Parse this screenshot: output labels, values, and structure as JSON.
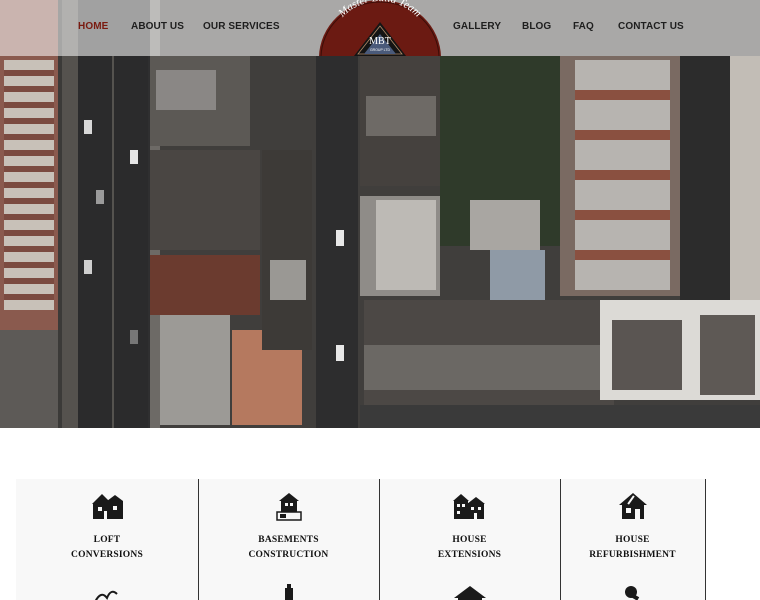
{
  "nav": {
    "left": [
      "HOME",
      "ABOUT US",
      "OUR SERVICES"
    ],
    "right": [
      "GALLERY",
      "BLOG",
      "FAQ",
      "CONTACT US"
    ],
    "active": "HOME"
  },
  "logo": {
    "arc_text": "Master Build Team",
    "initials": "MBT",
    "sub_text": "GROUP LTD"
  },
  "services": [
    {
      "line1": "LOFT",
      "line2": "CONVERSIONS",
      "icon": "house-icon"
    },
    {
      "line1": "BASEMENTS",
      "line2": "CONSTRUCTION",
      "icon": "basement-house-icon"
    },
    {
      "line1": "HOUSE",
      "line2": "EXTENSIONS",
      "icon": "extension-house-icon"
    },
    {
      "line1": "HOUSE",
      "line2": "REFURBISHMENT",
      "icon": "refurbish-house-icon"
    }
  ],
  "colors": {
    "accent": "#7a1b10",
    "logo_bg": "#6b1a12",
    "text": "#1e1e1e"
  }
}
